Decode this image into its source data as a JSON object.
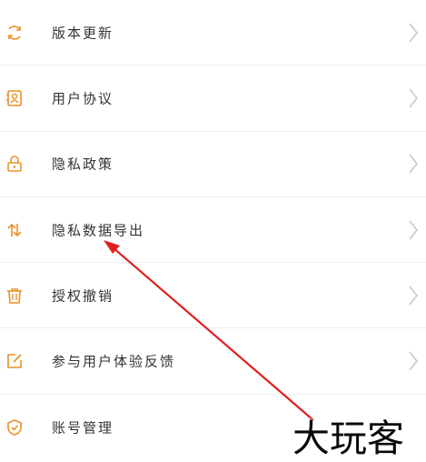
{
  "colors": {
    "accent": "#e8912a",
    "arrow": "#e02020",
    "chevron": "#c8c8c8"
  },
  "menu": {
    "items": [
      {
        "label": "版本更新",
        "icon": "refresh-icon"
      },
      {
        "label": "用户协议",
        "icon": "contact-card-icon"
      },
      {
        "label": "隐私政策",
        "icon": "lock-icon"
      },
      {
        "label": "隐私数据导出",
        "icon": "swap-arrows-icon"
      },
      {
        "label": "授权撤销",
        "icon": "trash-icon"
      },
      {
        "label": "参与用户体验反馈",
        "icon": "edit-icon"
      },
      {
        "label": "账号管理",
        "icon": "shield-check-icon"
      }
    ]
  },
  "watermark": {
    "text": "大玩客"
  }
}
